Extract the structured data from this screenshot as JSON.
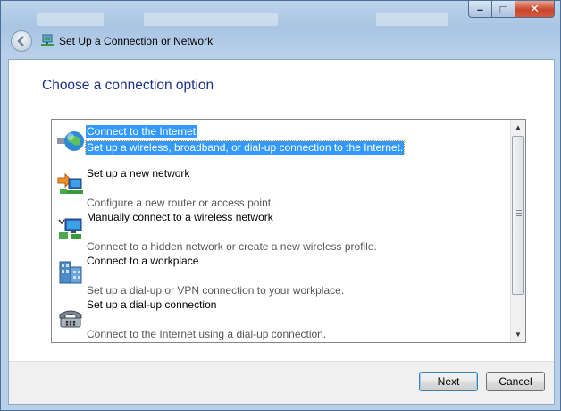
{
  "window": {
    "title": "Set Up a Connection or Network",
    "caption_buttons": {
      "minimize": "–",
      "maximize": "□",
      "close": "✕"
    }
  },
  "heading": "Choose a connection option",
  "options": [
    {
      "title": "Connect to the Internet",
      "description": "Set up a wireless, broadband, or dial-up connection to the Internet.",
      "icon": "globe-network-icon",
      "selected": true
    },
    {
      "title": "Set up a new network",
      "description": "Configure a new router or access point.",
      "icon": "new-network-icon",
      "selected": false
    },
    {
      "title": "Manually connect to a wireless network",
      "description": "Connect to a hidden network or create a new wireless profile.",
      "icon": "wireless-network-icon",
      "selected": false
    },
    {
      "title": "Connect to a workplace",
      "description": "Set up a dial-up or VPN connection to your workplace.",
      "icon": "workplace-building-icon",
      "selected": false
    },
    {
      "title": "Set up a dial-up connection",
      "description": "Connect to the Internet using a dial-up connection.",
      "icon": "dialup-phone-icon",
      "selected": false
    }
  ],
  "buttons": {
    "next": "Next",
    "cancel": "Cancel"
  },
  "colors": {
    "heading": "#1e3287",
    "selection": "#3399ff",
    "title_bar": "#a9c5e3"
  }
}
